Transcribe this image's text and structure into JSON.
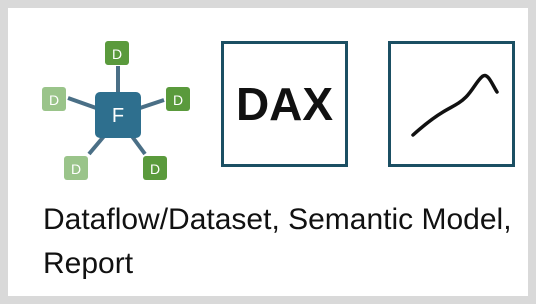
{
  "diagram": {
    "fact_label": "F",
    "dimension_label": "D",
    "dax_label": "DAX",
    "caption": "Dataflow/Dataset, Semantic Model, Report"
  },
  "colors": {
    "border": "#d9d9d9",
    "tile_border": "#1b4f63",
    "fact_fill": "#2e6f8e",
    "dimension_fill_dark": "#5a9a3c",
    "dimension_fill_light": "#9ac48a",
    "connector": "#4a6f86",
    "text": "#111111"
  },
  "icons": {
    "star_schema": "star-schema-icon",
    "dax": "dax-icon",
    "line_chart": "line-chart-icon"
  }
}
